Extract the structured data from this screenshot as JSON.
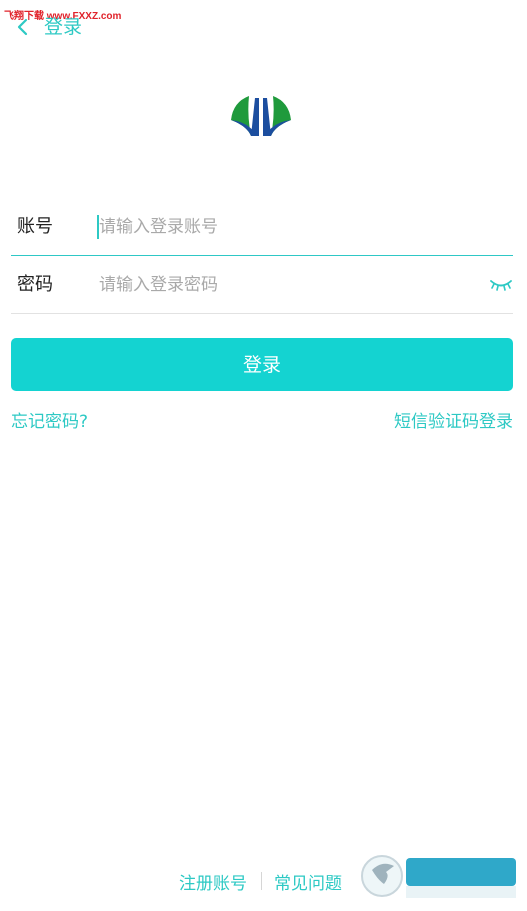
{
  "watermark": {
    "top_text": "飞翔下载 www.FXXZ.com",
    "brand_text": "飞翔下载",
    "url_text": "www.fxxz.com"
  },
  "nav": {
    "back_icon": "chevron-left-icon",
    "title": "登录"
  },
  "logo": {
    "icon": "app-logo",
    "colors": [
      "#1f9a3c",
      "#1c4e9f"
    ]
  },
  "form": {
    "account": {
      "label": "账号",
      "placeholder": "请输入登录账号",
      "value": ""
    },
    "password": {
      "label": "密码",
      "placeholder": "请输入登录密码",
      "value": "",
      "toggle_icon": "eye-closed-icon"
    }
  },
  "login_button": {
    "label": "登录"
  },
  "links": {
    "forgot": "忘记密码?",
    "sms_login": "短信验证码登录"
  },
  "footer": {
    "register": "注册账号",
    "faq": "常见问题"
  },
  "colors": {
    "accent": "#2dc9c4",
    "button": "#14d3d1"
  }
}
